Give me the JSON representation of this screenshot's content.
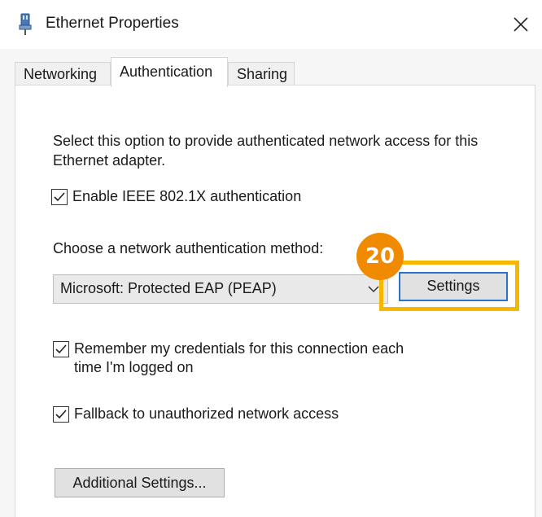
{
  "window": {
    "title": "Ethernet Properties",
    "icon": "network-adapter-icon",
    "close_icon": "close-icon"
  },
  "tabs": [
    {
      "label": "Networking",
      "active": false
    },
    {
      "label": "Authentication",
      "active": true
    },
    {
      "label": "Sharing",
      "active": false
    }
  ],
  "authentication": {
    "description": "Select this option to provide authenticated network access for this Ethernet adapter.",
    "enable_8021x": {
      "label": "Enable IEEE 802.1X authentication",
      "checked": true
    },
    "method_label": "Choose a network authentication method:",
    "method_select": {
      "selected": "Microsoft: Protected EAP (PEAP)"
    },
    "settings_label": "Settings",
    "remember_credentials": {
      "label_line1": "Remember my credentials for this connection each",
      "label_line2": "time I'm logged on",
      "checked": true
    },
    "fallback": {
      "label": "Fallback to unauthorized network access",
      "checked": true
    },
    "additional_settings_label": "Additional Settings..."
  },
  "annotation": {
    "step_number": "20",
    "badge_color": "#f08a00",
    "highlight_color": "#f5b700"
  }
}
